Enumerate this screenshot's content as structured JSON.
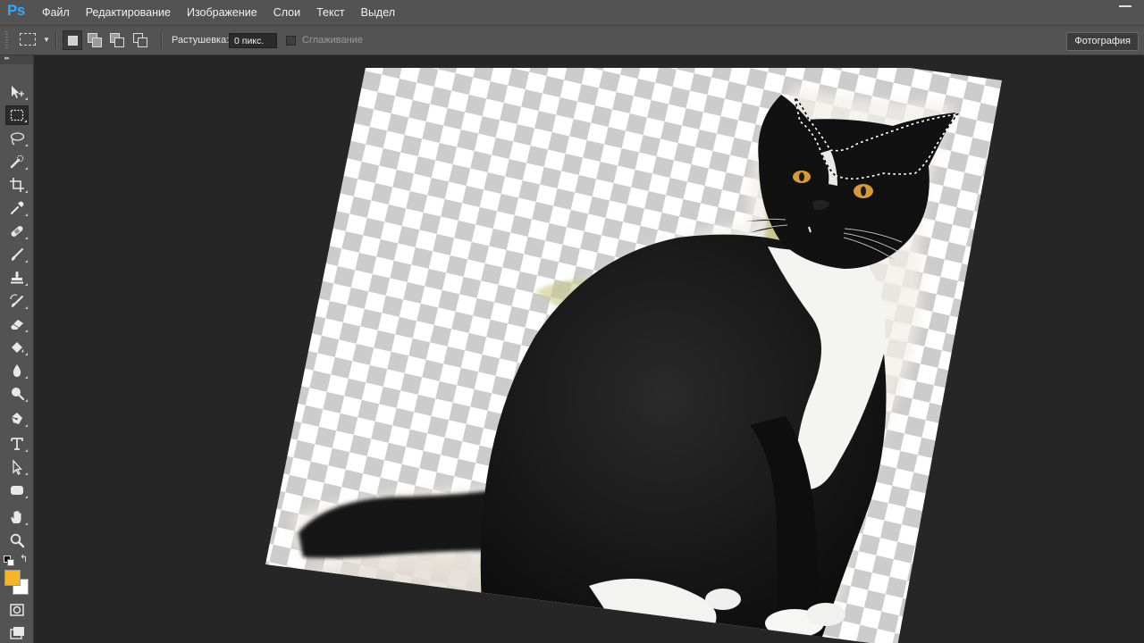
{
  "app": {
    "logo": "Ps"
  },
  "menu": [
    "Файл",
    "Редактирование",
    "Изображение",
    "Слои",
    "Текст",
    "Выдел"
  ],
  "options": {
    "feather_label": "Растушевка:",
    "feather_value": "0 пикс.",
    "antialias_label": "Сглаживание",
    "workspace": "Фотография"
  },
  "colors": {
    "foreground": "#f6b426",
    "background": "#ffffff",
    "ui_panel": "#535353",
    "workspace_bg": "#262626"
  },
  "tools": [
    {
      "name": "move-tool"
    },
    {
      "name": "rectangular-marquee-tool",
      "active": true
    },
    {
      "name": "lasso-tool"
    },
    {
      "name": "quick-selection-tool"
    },
    {
      "name": "crop-tool"
    },
    {
      "name": "eyedropper-tool"
    },
    {
      "name": "healing-brush-tool"
    },
    {
      "name": "brush-tool"
    },
    {
      "name": "clone-stamp-tool"
    },
    {
      "name": "history-brush-tool"
    },
    {
      "name": "eraser-tool"
    },
    {
      "name": "paint-bucket-tool"
    },
    {
      "name": "blur-tool"
    },
    {
      "name": "dodge-tool"
    },
    {
      "name": "pen-tool"
    },
    {
      "name": "type-tool"
    },
    {
      "name": "path-selection-tool"
    },
    {
      "name": "rectangle-shape-tool"
    },
    {
      "name": "hand-tool"
    },
    {
      "name": "zoom-tool"
    }
  ],
  "document": {
    "subject": "black-and-white cat on transparent background, rotated",
    "has_selection_marquee": true
  }
}
